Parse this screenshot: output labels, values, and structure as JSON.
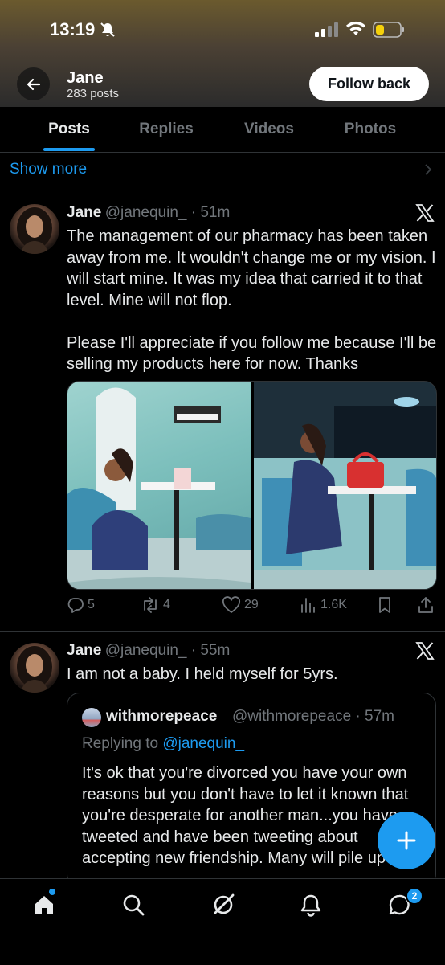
{
  "status_bar": {
    "time": "13:19"
  },
  "profile": {
    "name": "Jane",
    "post_count": "283 posts",
    "follow_label": "Follow back"
  },
  "tabs": [
    {
      "label": "Posts",
      "active": true
    },
    {
      "label": "Replies",
      "active": false
    },
    {
      "label": "Videos",
      "active": false
    },
    {
      "label": "Photos",
      "active": false
    }
  ],
  "show_more": "Show more",
  "tweets": [
    {
      "name": "Jane",
      "handle": "@janequin_ · 51m",
      "text": "The management of our pharmacy has been taken away from me. It wouldn't change me or my vision. I will start mine. It was my idea that carried it to that level. Mine will not flop.\n\nPlease I'll appreciate if you follow me because I'll be selling my products here for now. Thanks",
      "replies": "5",
      "reposts": "4",
      "likes": "29",
      "views": "1.6K"
    },
    {
      "name": "Jane",
      "handle": "@janequin_ · 55m",
      "text": "I am not a baby. I held myself for 5yrs.",
      "quote": {
        "name": "withmorepeace",
        "handle": "@withmorepeace · 57m",
        "replying_prefix": "Replying to ",
        "replying_to": "@janequin_",
        "text": "It's ok that you're divorced you have your own reasons but you don't have to let it known that you're desperate for another man...you have tweeted and have been tweeting about accepting new friendship. Many will pile up"
      }
    }
  ],
  "bottom_nav": {
    "messages_badge": "2"
  },
  "colors": {
    "accent": "#1d9bf0",
    "background": "#000000",
    "muted": "#71767b",
    "text": "#e7e9ea"
  }
}
